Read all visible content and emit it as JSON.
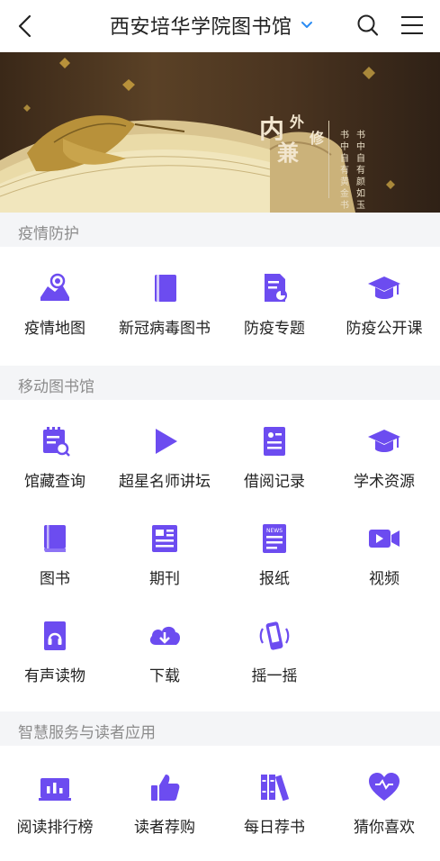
{
  "header": {
    "title": "西安培华学院图书馆"
  },
  "banner": {
    "seal_chars": [
      "内",
      "兼",
      "外",
      "修"
    ],
    "poem_left": "书中自有黄金书",
    "poem_right": "书中自有颜如玉"
  },
  "sections": [
    {
      "title": "疫情防护",
      "items": [
        {
          "label": "疫情地图",
          "icon": "epidemic-map-icon"
        },
        {
          "label": "新冠病毒图书",
          "icon": "book-icon"
        },
        {
          "label": "防疫专题",
          "icon": "topic-document-icon"
        },
        {
          "label": "防疫公开课",
          "icon": "graduation-cap-icon"
        }
      ]
    },
    {
      "title": "移动图书馆",
      "items": [
        {
          "label": "馆藏查询",
          "icon": "catalog-search-icon"
        },
        {
          "label": "超星名师讲坛",
          "icon": "play-icon"
        },
        {
          "label": "借阅记录",
          "icon": "borrow-record-icon"
        },
        {
          "label": "学术资源",
          "icon": "graduation-cap-icon"
        },
        {
          "label": "图书",
          "icon": "book-icon"
        },
        {
          "label": "期刊",
          "icon": "journal-icon"
        },
        {
          "label": "报纸",
          "icon": "newspaper-icon"
        },
        {
          "label": "视频",
          "icon": "video-camera-icon"
        },
        {
          "label": "有声读物",
          "icon": "audiobook-icon"
        },
        {
          "label": "下载",
          "icon": "cloud-download-icon"
        },
        {
          "label": "摇一摇",
          "icon": "shake-phone-icon"
        }
      ]
    },
    {
      "title": "智慧服务与读者应用",
      "items": [
        {
          "label": "阅读排行榜",
          "icon": "ranking-chart-icon"
        },
        {
          "label": "读者荐购",
          "icon": "thumbs-up-icon"
        },
        {
          "label": "每日荐书",
          "icon": "bookshelf-icon"
        },
        {
          "label": "猜你喜欢",
          "icon": "heart-icon"
        }
      ]
    }
  ],
  "colors": {
    "accent": "#6c4cf0",
    "section_bg": "#f4f5f7",
    "section_text": "#8c8c8c",
    "title_chevron": "#2b8cf3"
  }
}
